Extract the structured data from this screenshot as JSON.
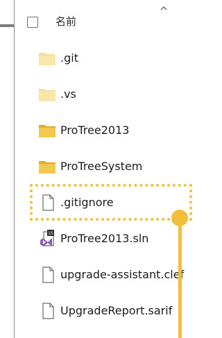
{
  "header": {
    "name_column": "名前"
  },
  "files": [
    {
      "name": ".git",
      "type": "folder"
    },
    {
      "name": ".vs",
      "type": "folder"
    },
    {
      "name": "ProTree2013",
      "type": "folder"
    },
    {
      "name": "ProTreeSystem",
      "type": "folder"
    },
    {
      "name": ".gitignore",
      "type": "file"
    },
    {
      "name": "ProTree2013.sln",
      "type": "solution"
    },
    {
      "name": "upgrade-assistant.clef",
      "type": "file"
    },
    {
      "name": "UpgradeReport.sarif",
      "type": "file"
    }
  ],
  "colors": {
    "highlight": "#f2bf3a",
    "folder": "#f2c94c",
    "folder_faded": "#f6de98"
  },
  "icons": {
    "folder": "folder-icon",
    "file": "file-icon",
    "solution": "visual-studio-solution-icon",
    "checkbox": "checkbox-icon",
    "sort": "chevron-up-icon"
  }
}
